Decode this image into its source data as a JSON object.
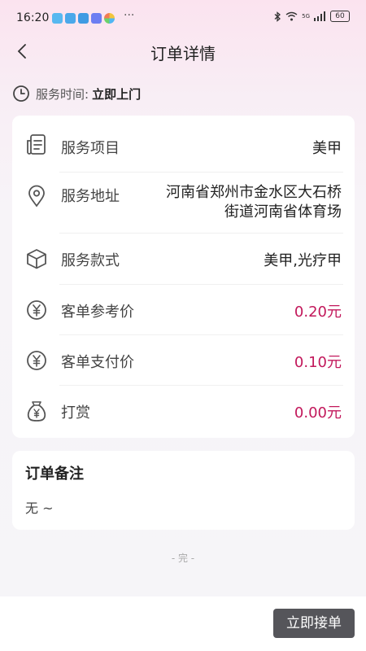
{
  "status_bar": {
    "time": "16:20",
    "more": "···",
    "network": "5G",
    "battery": "60"
  },
  "nav": {
    "title": "订单详情"
  },
  "service_time": {
    "label": "服务时间:",
    "value": "立即上门"
  },
  "details": [
    {
      "icon": "document-icon",
      "label": "服务项目",
      "value": "美甲",
      "value_lines": [
        "美甲"
      ]
    },
    {
      "icon": "location-pin-icon",
      "label": "服务地址",
      "value": "河南省郑州市金水区大石桥街道河南省体育场",
      "value_lines": [
        "河南省郑州市金水区大石桥",
        "街道河南省体育场"
      ]
    },
    {
      "icon": "box-icon",
      "label": "服务款式",
      "value": "美甲,光疗甲",
      "value_lines": [
        "美甲,光疗甲"
      ]
    },
    {
      "icon": "yuan-coin-icon",
      "label": "客单参考价",
      "value": "0.20元",
      "value_lines": [
        "0.20元"
      ]
    },
    {
      "icon": "yuan-coin-icon",
      "label": "客单支付价",
      "value": "0.10元",
      "value_lines": [
        "0.10元"
      ]
    },
    {
      "icon": "money-bag-icon",
      "label": "打赏",
      "value": "0.00元",
      "value_lines": [
        "0.00元"
      ]
    }
  ],
  "notes": {
    "title": "订单备注",
    "text": "无 ~"
  },
  "end_text": "- 完 -",
  "accept_button": {
    "label": "立即接单"
  },
  "colors": {
    "price": "#c2185b",
    "button_bg": "#55555a",
    "background_top": "#fbe3ef"
  }
}
